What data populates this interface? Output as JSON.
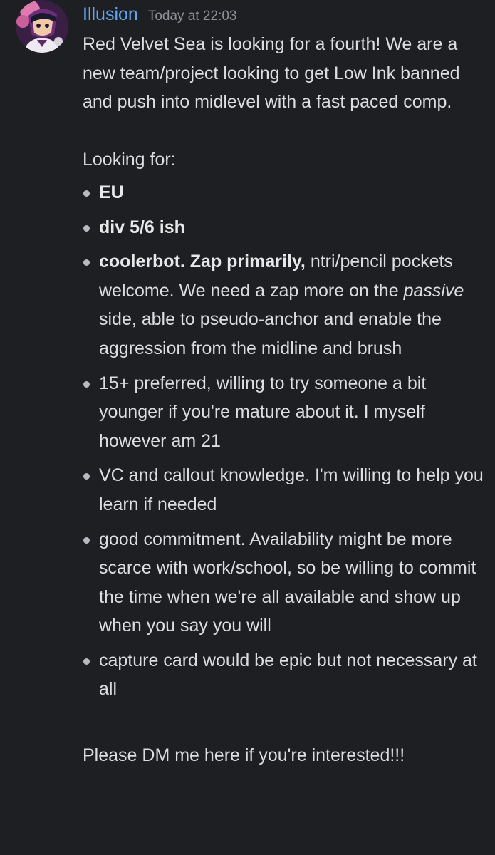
{
  "message": {
    "username": "Illusion",
    "timestamp": "Today at 22:03",
    "avatar_icon": "avatar-illustration",
    "username_color": "#5fa7f2",
    "intro": "Red Velvet Sea is looking for a fourth! We are a new team/project looking to get Low Ink banned and push into midlevel with a fast paced comp.",
    "looking_for_label": "Looking for:",
    "bullets": [
      {
        "bold": "EU",
        "text": ""
      },
      {
        "bold": "div 5/6 ish",
        "text": ""
      },
      {
        "bold": "coolerbot. Zap primarily,",
        "text_before_italic": " ntri/pencil pockets welcome. We need a zap more on the ",
        "italic": "passive",
        "text_after_italic": " side, able to pseudo-anchor and enable the aggression from the midline and brush"
      },
      {
        "bold": "",
        "text": "15+ preferred, willing to try someone a bit younger if you're mature about it. I myself however am 21"
      },
      {
        "bold": "",
        "text": "VC and callout knowledge. I'm willing to help you learn if needed"
      },
      {
        "bold": "",
        "text": "good commitment. Availability might be more scarce with work/school, so be willing to commit the time when we're all available and show up when you say you will"
      },
      {
        "bold": "",
        "text": "capture card would be epic but not necessary at all"
      }
    ],
    "closing": "Please DM me here if you're interested!!!"
  }
}
